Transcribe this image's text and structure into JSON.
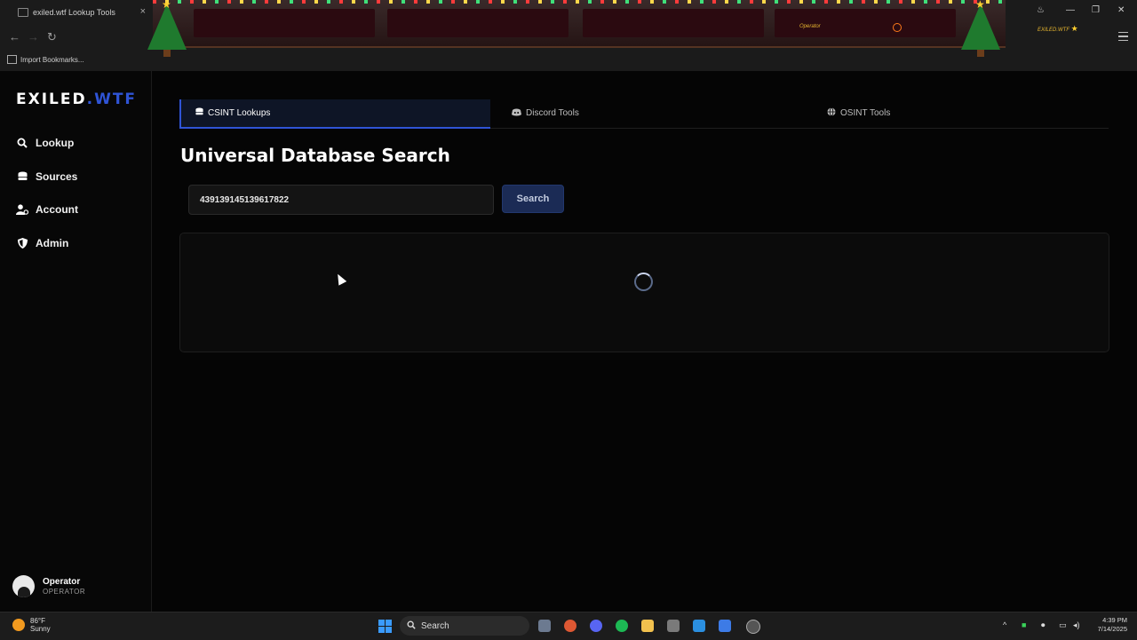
{
  "browser": {
    "tab_title": "exiled.wtf Lookup Tools",
    "bookmarks_label": "Import Bookmarks...",
    "banner_username": "Operator",
    "banner_brand": "EXILED.WTF"
  },
  "sidebar": {
    "logo_primary": "EXILED",
    "logo_accent": ".WTF",
    "items": [
      {
        "label": "Lookup",
        "icon": "search-icon"
      },
      {
        "label": "Sources",
        "icon": "database-icon"
      },
      {
        "label": "Account",
        "icon": "user-gear-icon"
      },
      {
        "label": "Admin",
        "icon": "shield-icon"
      }
    ],
    "user": {
      "name": "Operator",
      "role": "OPERATOR"
    }
  },
  "main": {
    "tabs": [
      {
        "label": "CSINT Lookups",
        "icon": "database-icon",
        "active": true
      },
      {
        "label": "Discord Tools",
        "icon": "discord-icon",
        "active": false
      },
      {
        "label": "OSINT Tools",
        "icon": "globe-icon",
        "active": false
      }
    ],
    "heading": "Universal Database Search",
    "search": {
      "value": "439139145139617822",
      "button_label": "Search"
    },
    "results": {
      "state": "loading"
    }
  },
  "taskbar": {
    "weather_temp": "86°F",
    "weather_desc": "Sunny",
    "search_label": "Search",
    "time": "4:39 PM",
    "date": "7/14/2025"
  },
  "colors": {
    "accent": "#2f54d6",
    "background": "#050505",
    "button_bg": "#1b2b55"
  }
}
